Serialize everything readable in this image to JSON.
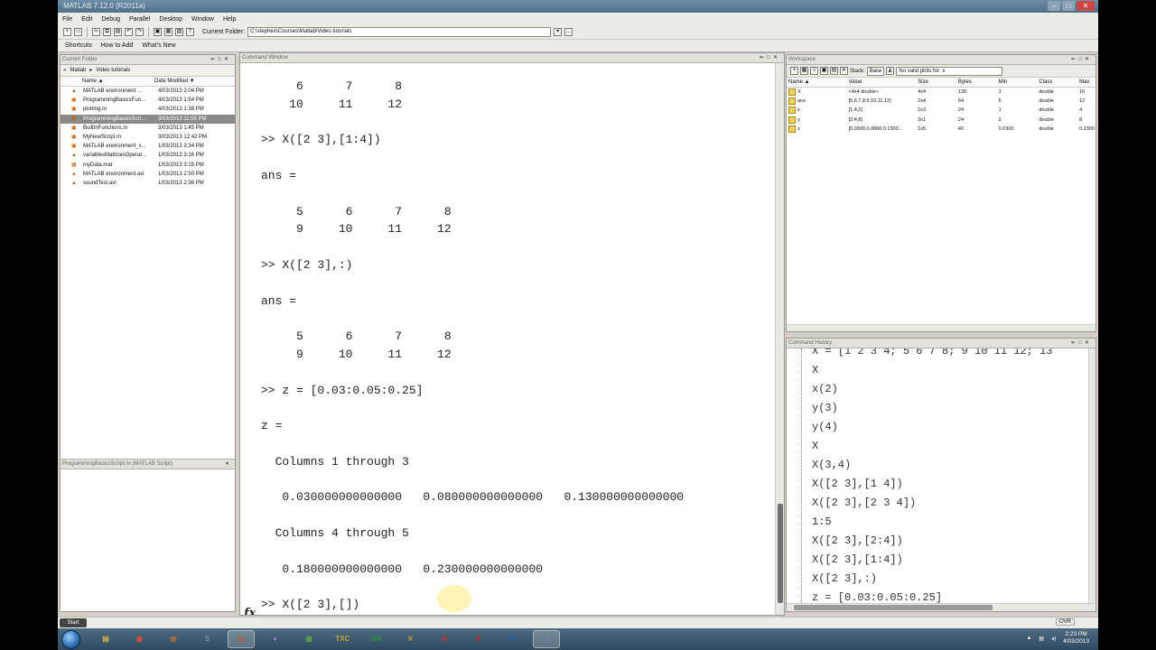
{
  "app": {
    "title": "MATLAB 7.12.0 (R2011a)"
  },
  "menu": [
    "File",
    "Edit",
    "Debug",
    "Parallel",
    "Desktop",
    "Window",
    "Help"
  ],
  "toolbar": {
    "current_folder_label": "Current Folder:",
    "current_folder_path": "C:\\stephen\\Courses\\Matlab\\Video tutorials"
  },
  "shortcuts": {
    "shortcuts_label": "Shortcuts",
    "how_to_add": "How to Add",
    "whats_new": "What's New"
  },
  "current_folder": {
    "title": "Current Folder",
    "breadcrumb": [
      "«",
      "Matlab",
      "▸",
      "Video tutorials"
    ],
    "columns": [
      "Name ▲",
      "Date Modified ▼"
    ],
    "files": [
      {
        "name": "MATLAB environment ...",
        "date": "4/03/2013 2:04 PM",
        "icon": "video-icon"
      },
      {
        "name": "ProgrammingBasicsFun...",
        "date": "4/03/2013 1:54 PM",
        "icon": "script-icon"
      },
      {
        "name": "plotting.m",
        "date": "4/03/2013 1:38 PM",
        "icon": "script-icon"
      },
      {
        "name": "ProgrammingBasicsScri...",
        "date": "3/03/2013 11:55 PM",
        "icon": "script-icon"
      },
      {
        "name": "BuiltInFunctions.m",
        "date": "3/03/2013 1:45 PM",
        "icon": "script-icon"
      },
      {
        "name": "MyNewScript.m",
        "date": "3/03/2013 12:42 PM",
        "icon": "script-icon"
      },
      {
        "name": "MATLAB environment_x...",
        "date": "1/03/2013 3:34 PM",
        "icon": "script-icon"
      },
      {
        "name": "variablesMatricesOperat...",
        "date": "1/03/2013 3:16 PM",
        "icon": "video-icon"
      },
      {
        "name": "myData.mat",
        "date": "1/03/2013 3:15 PM",
        "icon": "mat-file-icon"
      },
      {
        "name": "MATLAB environment.avi",
        "date": "1/03/2013 2:50 PM",
        "icon": "video-icon"
      },
      {
        "name": "soundTest.avi",
        "date": "1/03/2013 2:36 PM",
        "icon": "video-icon"
      }
    ],
    "details_title": "ProgrammingBasicsScript.m (MATLAB Script)"
  },
  "command_window": {
    "title": "Command Window",
    "lines": [
      "     6      7      8",
      "    10     11     12",
      "",
      ">> X([2 3],[1:4])",
      "",
      "ans =",
      "",
      "     5      6      7      8",
      "     9     10     11     12",
      "",
      ">> X([2 3],:)",
      "",
      "ans =",
      "",
      "     5      6      7      8",
      "     9     10     11     12",
      "",
      ">> z = [0.03:0.05:0.25]",
      "",
      "z =",
      "",
      "  Columns 1 through 3",
      "",
      "   0.030000000000000   0.080000000000000   0.130000000000000",
      "",
      "  Columns 4 through 5",
      "",
      "   0.180000000000000   0.230000000000000",
      "",
      ">> X([2 3],[])"
    ]
  },
  "workspace": {
    "title": "Workspace",
    "stack_label": "Stack:",
    "stack_value": "Base",
    "plot_selector": "No valid plots for: x",
    "columns": [
      "Name ▲",
      "Value",
      "Size",
      "Bytes",
      "Min",
      "Class",
      "Max"
    ],
    "variables": [
      {
        "name": "X",
        "value": "<4x4 double>",
        "size": "4x4",
        "bytes": "128",
        "min": "1",
        "class": "double",
        "max": "16"
      },
      {
        "name": "ans",
        "value": "[5,6,7,8;9,10,11,12]",
        "size": "2x4",
        "bytes": "64",
        "min": "5",
        "class": "double",
        "max": "12"
      },
      {
        "name": "x",
        "value": "[1,4,2]",
        "size": "1x3",
        "bytes": "24",
        "min": "1",
        "class": "double",
        "max": "4"
      },
      {
        "name": "y",
        "value": "[2;4;8]",
        "size": "3x1",
        "bytes": "24",
        "min": "2",
        "class": "double",
        "max": "8"
      },
      {
        "name": "z",
        "value": "[0.0300,0.0800,0.1300...",
        "size": "1x5",
        "bytes": "40",
        "min": "0.0300",
        "class": "double",
        "max": "0.2300"
      }
    ]
  },
  "command_history": {
    "title": "Command History",
    "lines": [
      "X = [1 2 3 4; 5 6 7 8; 9 10 11 12; 13",
      "X",
      "x(2)",
      "y(3)",
      "y(4)",
      "X",
      "X(3,4)",
      "X([2 3],[1 4])",
      "X([2 3],[2 3 4])",
      "1:5",
      "X([2 3],[2:4])",
      "X([2 3],[1:4])",
      "X([2 3],:)",
      "z = [0.03:0.05:0.25]"
    ]
  },
  "status": {
    "start_label": "Start",
    "ovr": "OVR"
  },
  "taskbar": {
    "apps": [
      "explorer",
      "chrome",
      "firefox",
      "app-s",
      "matlab",
      "app-circle",
      "app-green",
      "TXC",
      "Dw",
      "app-x",
      "app-red",
      "acrobat",
      "Word",
      "app-window"
    ],
    "clock_time": "2:23 PM",
    "clock_date": "4/03/2013"
  }
}
